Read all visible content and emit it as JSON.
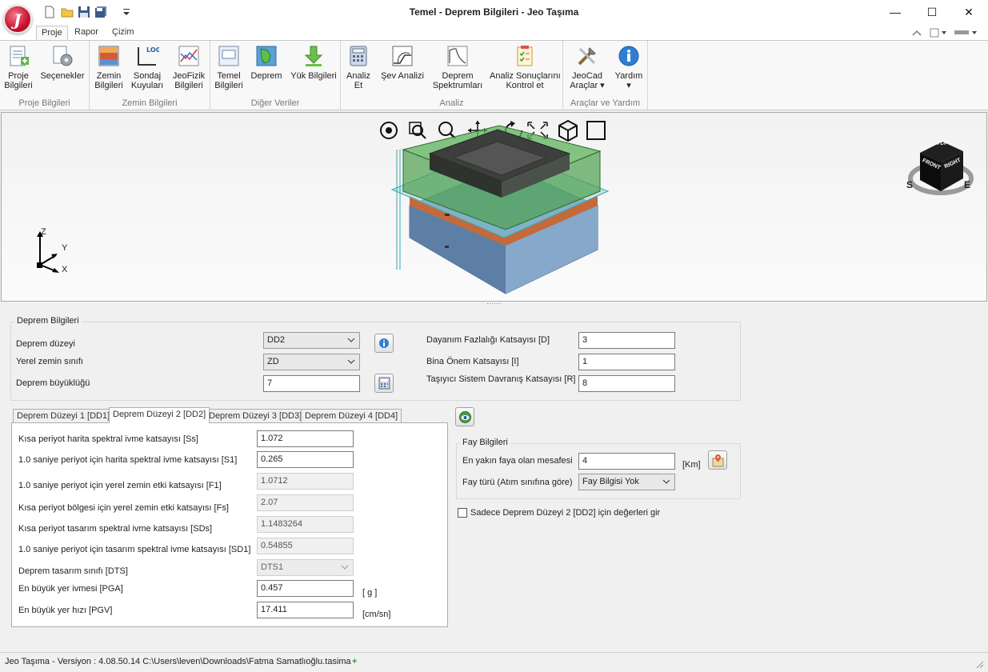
{
  "window": {
    "title": "Temel - Deprem Bilgileri - Jeo Taşıma",
    "logo_letter": "J",
    "minimize": "—",
    "maximize": "☐",
    "close": "✕"
  },
  "ribbon": {
    "tabs": [
      {
        "label": "Proje",
        "active": true
      },
      {
        "label": "Rapor",
        "active": false
      },
      {
        "label": "Çizim",
        "active": false
      }
    ],
    "groups": [
      {
        "label": "Proje Bilgileri",
        "buttons": [
          {
            "label": "Proje\nBilgileri",
            "icon": "project-info-icon"
          },
          {
            "label": "Seçenekler",
            "icon": "options-gear-icon"
          }
        ]
      },
      {
        "label": "Zemin Bilgileri",
        "buttons": [
          {
            "label": "Zemin\nBilgileri",
            "icon": "soil-layers-icon"
          },
          {
            "label": "Sondaj\nKuyuları",
            "icon": "borehole-log-icon"
          },
          {
            "label": "JeoFizik\nBilgileri",
            "icon": "geophysics-chart-icon"
          }
        ]
      },
      {
        "label": "Diğer Veriler",
        "buttons": [
          {
            "label": "Temel\nBilgileri",
            "icon": "foundation-icon"
          },
          {
            "label": "Deprem",
            "icon": "earthquake-map-icon"
          },
          {
            "label": "Yük Bilgileri",
            "icon": "load-arrow-icon"
          }
        ]
      },
      {
        "label": "Analiz",
        "buttons": [
          {
            "label": "Analiz\nEt",
            "icon": "calculator-icon"
          },
          {
            "label": "Şev Analizi",
            "icon": "slope-analysis-icon"
          },
          {
            "label": "Deprem\nSpektrumları",
            "icon": "spectrum-curve-icon"
          },
          {
            "label": "Analiz Sonuçlarını\nKontrol et",
            "icon": "checklist-icon"
          }
        ]
      },
      {
        "label": "Araçlar ve Yardım",
        "buttons": [
          {
            "label": "JeoCad\nAraçlar ▾",
            "icon": "tools-icon"
          },
          {
            "label": "Yardım\n▾",
            "icon": "info-help-icon"
          }
        ]
      }
    ]
  },
  "viewport": {
    "axis_labels": {
      "z": "Z",
      "y": "Y",
      "x": "X"
    },
    "cube_labels": {
      "top": "TOP",
      "front": "FRONT",
      "right": "RIGHT",
      "south": "S",
      "east": "E"
    }
  },
  "deprem_bilgileri": {
    "title": "Deprem Bilgileri",
    "deprem_duzeyi_label": "Deprem düzeyi",
    "deprem_duzeyi_value": "DD2",
    "yerel_zemin_label": "Yerel zemin sınıfı",
    "yerel_zemin_value": "ZD",
    "buyukluk_label": "Deprem büyüklüğü",
    "buyukluk_value": "7",
    "dayanim_label": "Dayanım Fazlalığı Katsayısı [D]",
    "dayanim_value": "3",
    "bina_onem_label": "Bina Önem Katsayısı [I]",
    "bina_onem_value": "1",
    "tasiyici_label": "Taşıyıcı Sistem Davranış Katsayısı  [R]",
    "tasiyici_value": "8"
  },
  "tabs": [
    {
      "label": "Deprem Düzeyi 1 [DD1]",
      "active": false
    },
    {
      "label": "Deprem Düzeyi 2 [DD2]",
      "active": true
    },
    {
      "label": "Deprem Düzeyi 3 [DD3]",
      "active": false
    },
    {
      "label": "Deprem Düzeyi 4 [DD4]",
      "active": false
    }
  ],
  "dd2": {
    "ss_label": "Kısa periyot harita spektral ivme katsayısı [Ss]",
    "ss_value": "1.072",
    "s1_label": "1.0 saniye periyot için harita spektral ivme katsayısı [S1]",
    "s1_value": "0.265",
    "f1_label": "1.0 saniye periyot için yerel zemin etki katsayısı [F1]",
    "f1_value": "1.0712",
    "fs_label": "Kısa periyot bölgesi için yerel zemin etki katsayısı [Fs]",
    "fs_value": "2.07",
    "sds_label": "Kısa periyot tasarım spektral ivme katsayısı  [SDs]",
    "sds_value": "1.1483264",
    "sd1_label": "1.0 saniye periyot için tasarım spektral ivme katsayısı [SD1]",
    "sd1_value": "0.54855",
    "dts_label": "Deprem tasarım sınıfı [DTS]",
    "dts_value": "DTS1",
    "pga_label": "En büyük yer ivmesi [PGA]",
    "pga_value": "0.457",
    "pga_unit": "[ g ]",
    "pgv_label": "En büyük yer hızı [PGV]",
    "pgv_value": "17.411",
    "pgv_unit": "[cm/sn]"
  },
  "fay": {
    "title": "Fay Bilgileri",
    "mesafe_label": "En yakın faya olan mesafesi",
    "mesafe_value": "4",
    "mesafe_unit": "[Km]",
    "tur_label": "Fay türü (Atım sınıfına göre)",
    "tur_value": "Fay Bilgisi Yok"
  },
  "sadece_checkbox_label": "Sadece Deprem Düzeyi 2 [DD2] için değerleri gir",
  "status": {
    "text": "Jeo Taşıma - Versiyon : 4.08.50.14  C:\\Users\\leven\\Downloads\\Fatma Samatlıoğlu.tasima",
    "plus": "+"
  }
}
